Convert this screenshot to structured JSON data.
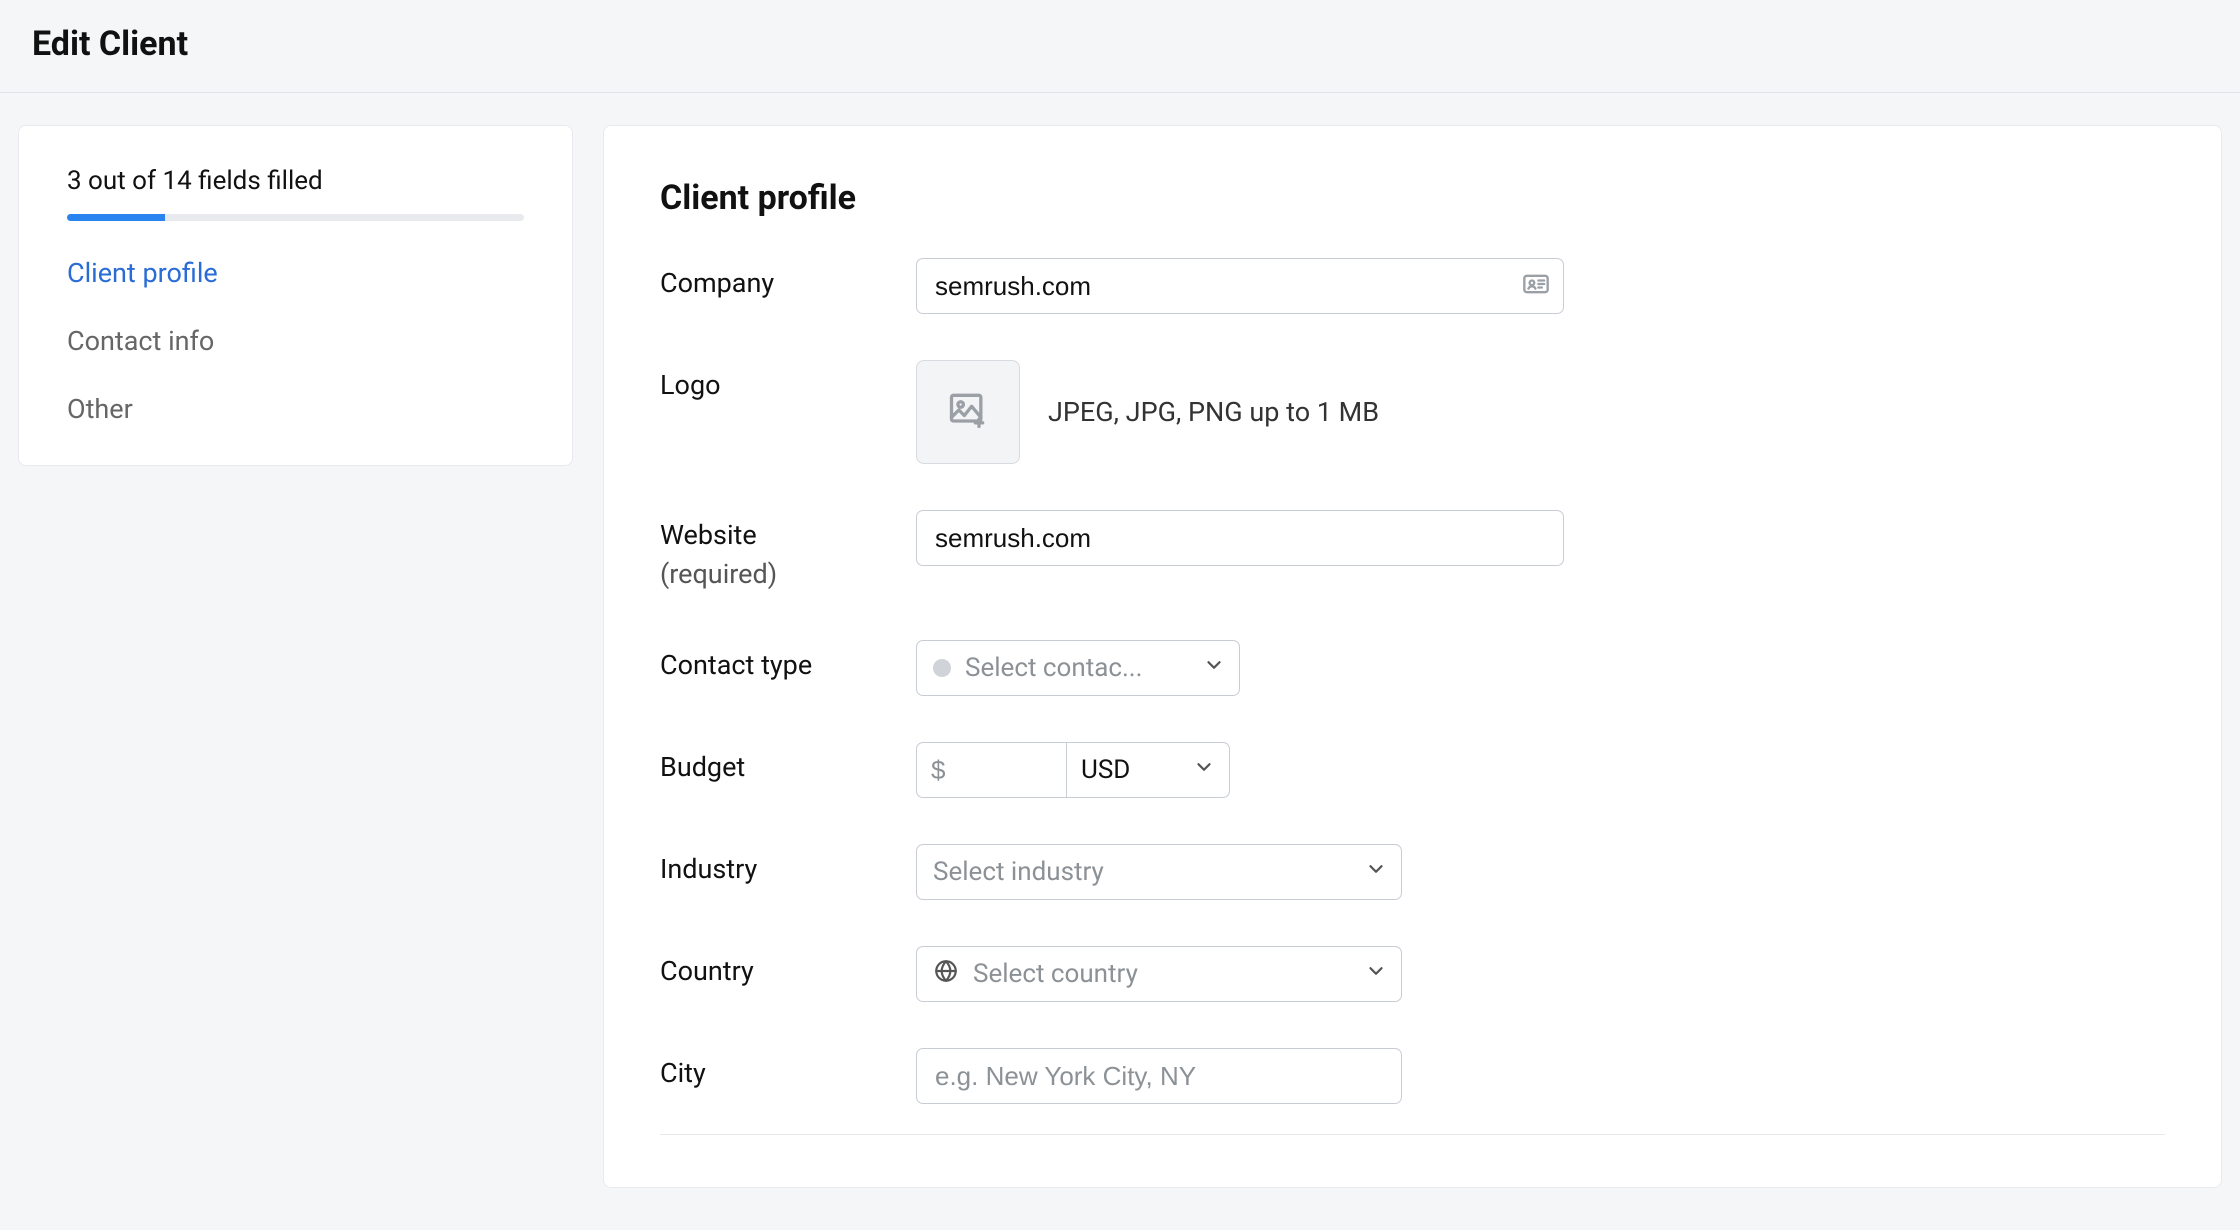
{
  "header": {
    "title": "Edit Client"
  },
  "sidebar": {
    "progress_text": "3 out of 14 fields filled",
    "progress_percent": 21.4,
    "nav": [
      {
        "label": "Client profile",
        "active": true
      },
      {
        "label": "Contact info",
        "active": false
      },
      {
        "label": "Other",
        "active": false
      }
    ]
  },
  "section": {
    "title": "Client profile"
  },
  "fields": {
    "company": {
      "label": "Company",
      "value": "semrush.com"
    },
    "logo": {
      "label": "Logo",
      "hint": "JPEG, JPG, PNG up to 1 MB"
    },
    "website": {
      "label": "Website",
      "required_text": "(required)",
      "value": "semrush.com"
    },
    "contact_type": {
      "label": "Contact type",
      "placeholder": "Select contac..."
    },
    "budget": {
      "label": "Budget",
      "amount_prefix": "$",
      "currency": "USD"
    },
    "industry": {
      "label": "Industry",
      "placeholder": "Select industry"
    },
    "country": {
      "label": "Country",
      "placeholder": "Select country"
    },
    "city": {
      "label": "City",
      "placeholder": "e.g. New York City, NY"
    }
  }
}
